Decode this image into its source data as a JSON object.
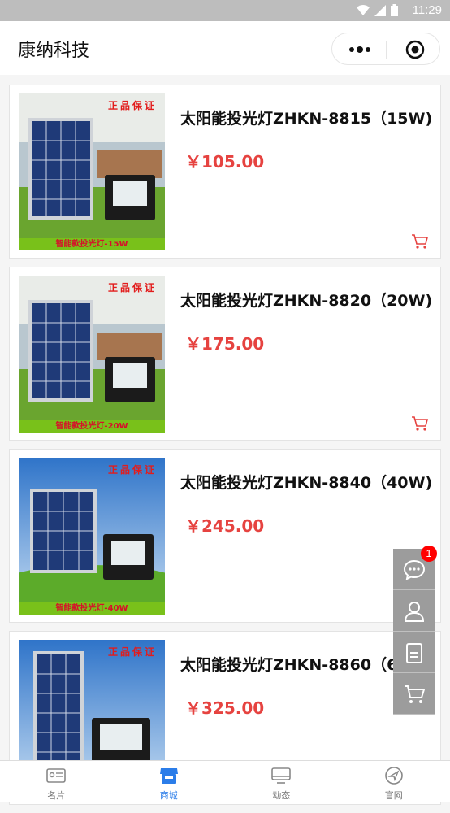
{
  "status_bar": {
    "time": "11:29"
  },
  "header": {
    "title": "康纳科技"
  },
  "products": [
    {
      "name": "太阳能投光灯ZHKN-8815（15W)",
      "price": "￥105.00",
      "stamp": "正品保证",
      "banner": "智能款投光灯-15W"
    },
    {
      "name": "太阳能投光灯ZHKN-8820（20W)",
      "price": "￥175.00",
      "stamp": "正品保证",
      "banner": "智能款投光灯-20W"
    },
    {
      "name": "太阳能投光灯ZHKN-8840（40W)",
      "price": "￥245.00",
      "stamp": "正品保证",
      "banner": "智能款投光灯-40W"
    },
    {
      "name": "太阳能投光灯ZHKN-8860（60W)",
      "price": "￥325.00",
      "stamp": "正品保证",
      "banner": ""
    }
  ],
  "float_bar": {
    "badge_count": "1"
  },
  "tabbar": {
    "items": [
      {
        "label": "名片",
        "icon": "card-icon"
      },
      {
        "label": "商城",
        "icon": "shop-icon"
      },
      {
        "label": "动态",
        "icon": "monitor-icon"
      },
      {
        "label": "官网",
        "icon": "compass-icon"
      }
    ]
  },
  "colors": {
    "price": "#e64340",
    "active_tab": "#2b7de9",
    "float_bg": "#9c9c9c"
  }
}
